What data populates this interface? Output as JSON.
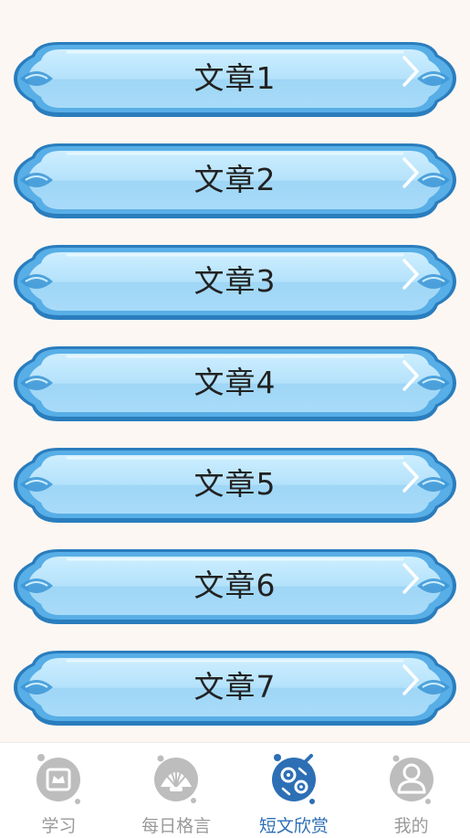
{
  "articles": [
    {
      "title": "文章1"
    },
    {
      "title": "文章2"
    },
    {
      "title": "文章3"
    },
    {
      "title": "文章4"
    },
    {
      "title": "文章5"
    },
    {
      "title": "文章6"
    },
    {
      "title": "文章7"
    }
  ],
  "tabbar": {
    "active_index": 2,
    "tabs": [
      {
        "label": "学习",
        "icon": "crown-icon"
      },
      {
        "label": "每日格言",
        "icon": "shell-icon"
      },
      {
        "label": "短文欣赏",
        "icon": "gears-icon"
      },
      {
        "label": "我的",
        "icon": "user-icon"
      }
    ]
  },
  "colors": {
    "card_fill": "#a9dcf8",
    "card_border": "#2f86c6",
    "tab_active": "#2d6fb5",
    "tab_inactive": "#9a9a9a"
  }
}
